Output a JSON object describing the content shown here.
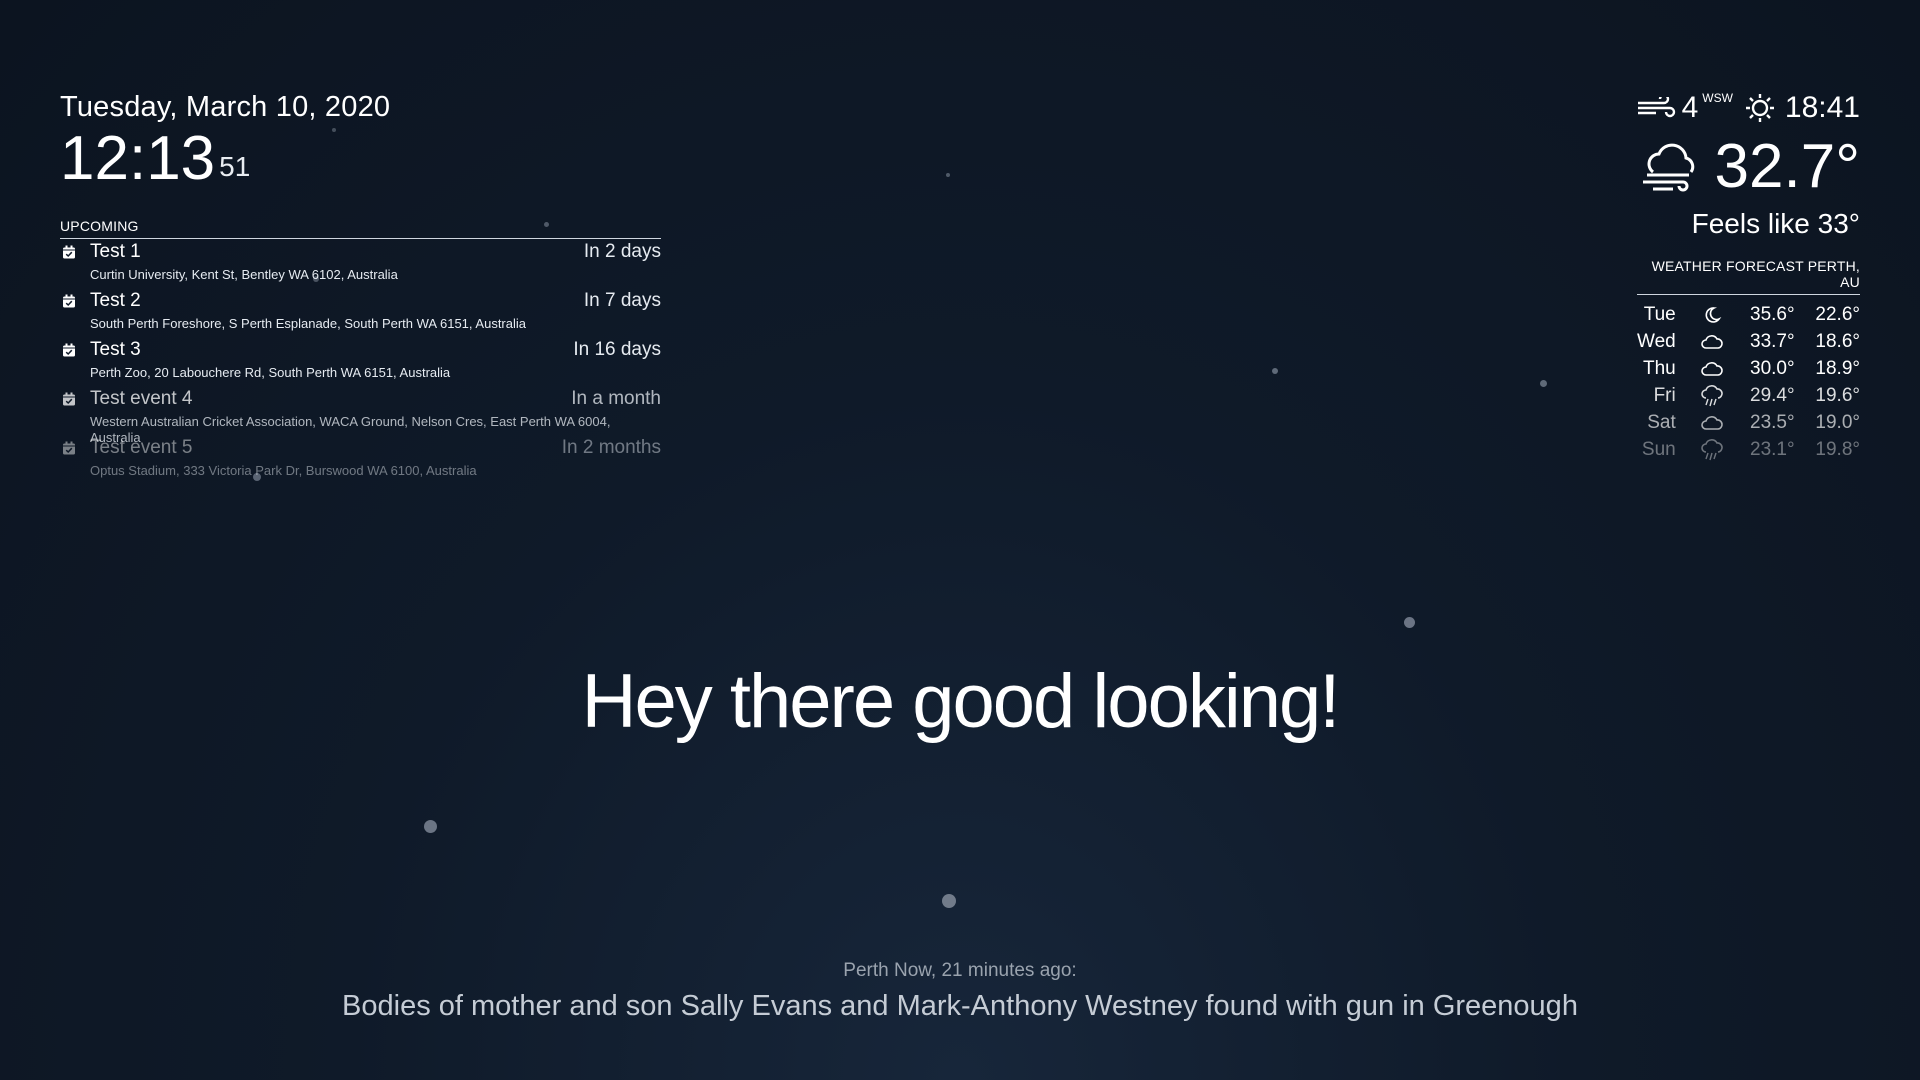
{
  "clock": {
    "date": "Tuesday, March 10, 2020",
    "time": "12:13",
    "seconds": "51"
  },
  "calendar": {
    "header": "UPCOMING",
    "icon": "calendar-check-icon",
    "events": [
      {
        "title": "Test 1",
        "when": "In 2 days",
        "location": "Curtin University, Kent St, Bentley WA 6102, Australia",
        "opacity": 1
      },
      {
        "title": "Test 2",
        "when": "In 7 days",
        "location": "South Perth Foreshore, S Perth Esplanade, South Perth WA 6151, Australia",
        "opacity": 1
      },
      {
        "title": "Test 3",
        "when": "In 16 days",
        "location": "Perth Zoo, 20 Labouchere Rd, South Perth WA 6151, Australia",
        "opacity": 1
      },
      {
        "title": "Test event 4",
        "when": "In a month",
        "location": "Western Australian Cricket Association, WACA Ground, Nelson Cres, East Perth WA 6004, Australia",
        "opacity": 0.75
      },
      {
        "title": "Test event 5",
        "when": "In 2 months",
        "location": "Optus Stadium, 333 Victoria Park Dr, Burswood WA 6100, Australia",
        "opacity": 0.45
      }
    ]
  },
  "current_weather": {
    "wind_speed": "4",
    "wind_direction": "WSW",
    "sunset_time": "18:41",
    "temperature": "32.7°",
    "feels_like": "Feels like 33°",
    "condition_icon": "cloud-wind-icon"
  },
  "forecast": {
    "header": "WEATHER FORECAST PERTH, AU",
    "days": [
      {
        "day": "Tue",
        "icon": "moon-icon",
        "max": "35.6°",
        "min": "22.6°",
        "opacity": 1
      },
      {
        "day": "Wed",
        "icon": "cloud-icon",
        "max": "33.7°",
        "min": "18.6°",
        "opacity": 1
      },
      {
        "day": "Thu",
        "icon": "cloud-icon",
        "max": "30.0°",
        "min": "18.9°",
        "opacity": 1
      },
      {
        "day": "Fri",
        "icon": "rain-icon",
        "max": "29.4°",
        "min": "19.6°",
        "opacity": 0.85
      },
      {
        "day": "Sat",
        "icon": "cloud-icon",
        "max": "23.5°",
        "min": "19.0°",
        "opacity": 0.65
      },
      {
        "day": "Sun",
        "icon": "rain-icon",
        "max": "23.1°",
        "min": "19.8°",
        "opacity": 0.4
      }
    ]
  },
  "compliment": "Hey there good looking!",
  "news": {
    "source": "Perth Now, 21 minutes ago:",
    "headline": "Bodies of mother and son Sally Evans and Mark-Anthony Westney found with gun in Greenough"
  }
}
